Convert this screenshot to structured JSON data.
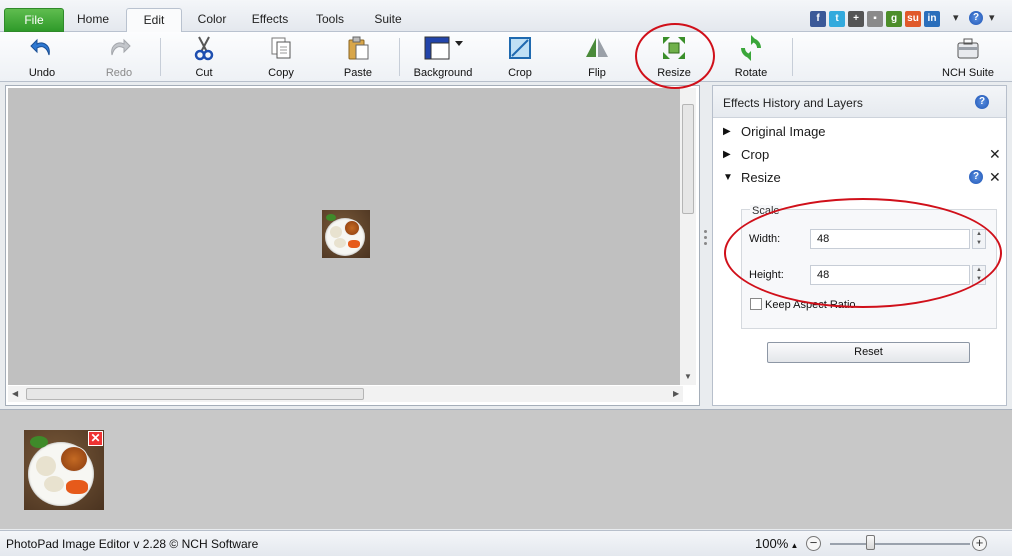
{
  "menu": {
    "tabs": [
      "File",
      "Home",
      "Edit",
      "Color",
      "Effects",
      "Tools",
      "Suite"
    ],
    "active_tab": "Edit"
  },
  "social_icons": [
    "facebook-icon",
    "twitter-icon",
    "google-plus-icon",
    "delicious-icon",
    "digg-icon",
    "stumbleupon-icon",
    "linkedin-icon"
  ],
  "toolbar": {
    "undo": "Undo",
    "redo": "Redo",
    "cut": "Cut",
    "copy": "Copy",
    "paste": "Paste",
    "background": "Background",
    "crop": "Crop",
    "flip": "Flip",
    "resize": "Resize",
    "rotate": "Rotate",
    "nch_suite": "NCH Suite"
  },
  "panel": {
    "title": "Effects History and Layers",
    "layers": [
      "Original Image",
      "Crop",
      "Resize"
    ],
    "scale_label": "Scale",
    "width_label": "Width:",
    "width_value": "48",
    "height_label": "Height:",
    "height_value": "48",
    "keep_aspect": "Keep Aspect Ratio",
    "keep_aspect_checked": false,
    "reset": "Reset"
  },
  "status": {
    "text": "PhotoPad Image Editor v 2.28 © NCH Software",
    "zoom": "100%"
  },
  "colors": {
    "file_tab": "#2f9a2a",
    "annotation": "#d0101a",
    "canvas": "#c0c0c0"
  }
}
